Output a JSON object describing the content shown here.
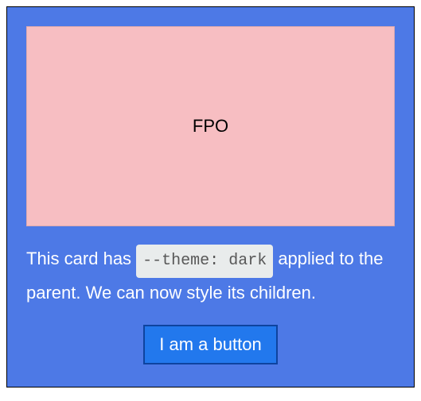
{
  "placeholder": {
    "label": "FPO"
  },
  "description": {
    "before": "This card has ",
    "code": "--theme: dark",
    "after": " applied to the parent. We can now style its children."
  },
  "button": {
    "label": "I am a button"
  }
}
